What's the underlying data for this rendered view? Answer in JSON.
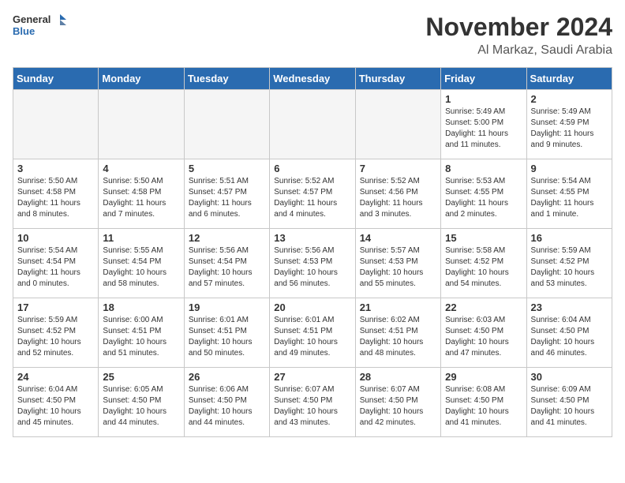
{
  "header": {
    "logo_general": "General",
    "logo_blue": "Blue",
    "month": "November 2024",
    "location": "Al Markaz, Saudi Arabia"
  },
  "weekdays": [
    "Sunday",
    "Monday",
    "Tuesday",
    "Wednesday",
    "Thursday",
    "Friday",
    "Saturday"
  ],
  "weeks": [
    [
      {
        "day": "",
        "empty": true
      },
      {
        "day": "",
        "empty": true
      },
      {
        "day": "",
        "empty": true
      },
      {
        "day": "",
        "empty": true
      },
      {
        "day": "",
        "empty": true
      },
      {
        "day": "1",
        "empty": false,
        "sunrise": "5:49 AM",
        "sunset": "5:00 PM",
        "daylight": "11 hours and 11 minutes."
      },
      {
        "day": "2",
        "empty": false,
        "sunrise": "5:49 AM",
        "sunset": "4:59 PM",
        "daylight": "11 hours and 9 minutes."
      }
    ],
    [
      {
        "day": "3",
        "empty": false,
        "sunrise": "5:50 AM",
        "sunset": "4:58 PM",
        "daylight": "11 hours and 8 minutes."
      },
      {
        "day": "4",
        "empty": false,
        "sunrise": "5:50 AM",
        "sunset": "4:58 PM",
        "daylight": "11 hours and 7 minutes."
      },
      {
        "day": "5",
        "empty": false,
        "sunrise": "5:51 AM",
        "sunset": "4:57 PM",
        "daylight": "11 hours and 6 minutes."
      },
      {
        "day": "6",
        "empty": false,
        "sunrise": "5:52 AM",
        "sunset": "4:57 PM",
        "daylight": "11 hours and 4 minutes."
      },
      {
        "day": "7",
        "empty": false,
        "sunrise": "5:52 AM",
        "sunset": "4:56 PM",
        "daylight": "11 hours and 3 minutes."
      },
      {
        "day": "8",
        "empty": false,
        "sunrise": "5:53 AM",
        "sunset": "4:55 PM",
        "daylight": "11 hours and 2 minutes."
      },
      {
        "day": "9",
        "empty": false,
        "sunrise": "5:54 AM",
        "sunset": "4:55 PM",
        "daylight": "11 hours and 1 minute."
      }
    ],
    [
      {
        "day": "10",
        "empty": false,
        "sunrise": "5:54 AM",
        "sunset": "4:54 PM",
        "daylight": "11 hours and 0 minutes."
      },
      {
        "day": "11",
        "empty": false,
        "sunrise": "5:55 AM",
        "sunset": "4:54 PM",
        "daylight": "10 hours and 58 minutes."
      },
      {
        "day": "12",
        "empty": false,
        "sunrise": "5:56 AM",
        "sunset": "4:54 PM",
        "daylight": "10 hours and 57 minutes."
      },
      {
        "day": "13",
        "empty": false,
        "sunrise": "5:56 AM",
        "sunset": "4:53 PM",
        "daylight": "10 hours and 56 minutes."
      },
      {
        "day": "14",
        "empty": false,
        "sunrise": "5:57 AM",
        "sunset": "4:53 PM",
        "daylight": "10 hours and 55 minutes."
      },
      {
        "day": "15",
        "empty": false,
        "sunrise": "5:58 AM",
        "sunset": "4:52 PM",
        "daylight": "10 hours and 54 minutes."
      },
      {
        "day": "16",
        "empty": false,
        "sunrise": "5:59 AM",
        "sunset": "4:52 PM",
        "daylight": "10 hours and 53 minutes."
      }
    ],
    [
      {
        "day": "17",
        "empty": false,
        "sunrise": "5:59 AM",
        "sunset": "4:52 PM",
        "daylight": "10 hours and 52 minutes."
      },
      {
        "day": "18",
        "empty": false,
        "sunrise": "6:00 AM",
        "sunset": "4:51 PM",
        "daylight": "10 hours and 51 minutes."
      },
      {
        "day": "19",
        "empty": false,
        "sunrise": "6:01 AM",
        "sunset": "4:51 PM",
        "daylight": "10 hours and 50 minutes."
      },
      {
        "day": "20",
        "empty": false,
        "sunrise": "6:01 AM",
        "sunset": "4:51 PM",
        "daylight": "10 hours and 49 minutes."
      },
      {
        "day": "21",
        "empty": false,
        "sunrise": "6:02 AM",
        "sunset": "4:51 PM",
        "daylight": "10 hours and 48 minutes."
      },
      {
        "day": "22",
        "empty": false,
        "sunrise": "6:03 AM",
        "sunset": "4:50 PM",
        "daylight": "10 hours and 47 minutes."
      },
      {
        "day": "23",
        "empty": false,
        "sunrise": "6:04 AM",
        "sunset": "4:50 PM",
        "daylight": "10 hours and 46 minutes."
      }
    ],
    [
      {
        "day": "24",
        "empty": false,
        "sunrise": "6:04 AM",
        "sunset": "4:50 PM",
        "daylight": "10 hours and 45 minutes."
      },
      {
        "day": "25",
        "empty": false,
        "sunrise": "6:05 AM",
        "sunset": "4:50 PM",
        "daylight": "10 hours and 44 minutes."
      },
      {
        "day": "26",
        "empty": false,
        "sunrise": "6:06 AM",
        "sunset": "4:50 PM",
        "daylight": "10 hours and 44 minutes."
      },
      {
        "day": "27",
        "empty": false,
        "sunrise": "6:07 AM",
        "sunset": "4:50 PM",
        "daylight": "10 hours and 43 minutes."
      },
      {
        "day": "28",
        "empty": false,
        "sunrise": "6:07 AM",
        "sunset": "4:50 PM",
        "daylight": "10 hours and 42 minutes."
      },
      {
        "day": "29",
        "empty": false,
        "sunrise": "6:08 AM",
        "sunset": "4:50 PM",
        "daylight": "10 hours and 41 minutes."
      },
      {
        "day": "30",
        "empty": false,
        "sunrise": "6:09 AM",
        "sunset": "4:50 PM",
        "daylight": "10 hours and 41 minutes."
      }
    ]
  ]
}
